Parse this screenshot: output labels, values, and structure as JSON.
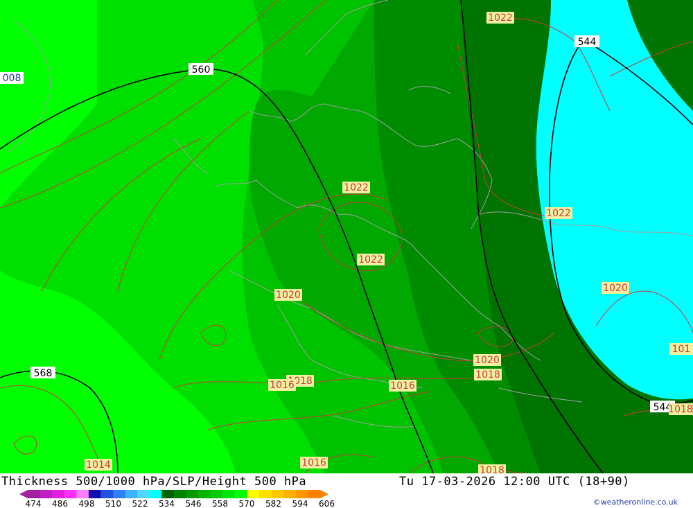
{
  "map": {
    "colors": {
      "outer": "#00ff00",
      "band1": "#00e000",
      "band2": "#00c300",
      "band3": "#00a800",
      "band4": "#008c00",
      "band5": "#007400",
      "cold": "#00ffff",
      "isobar": "#c83c3c",
      "height": "#000000",
      "border": "#a0a0a0"
    },
    "height_labels": [
      "560",
      "544",
      "568",
      "544"
    ],
    "pressure_labels": [
      "1022",
      "1022",
      "1022",
      "1022",
      "1020",
      "1020",
      "1020",
      "1018",
      "1018",
      "1016",
      "1016",
      "1014",
      "1016",
      "1018",
      "1018",
      "1018"
    ],
    "edge_labels": [
      "008",
      "101",
      "1018"
    ]
  },
  "footer": {
    "title": "Thickness 500/1000 hPa/SLP/Height 500 hPa",
    "valid": "Tu 17-03-2026 12:00 UTC (18+90)",
    "credit": "©weatheronline.co.uk"
  },
  "legend": {
    "ticks": [
      "474",
      "486",
      "498",
      "510",
      "522",
      "534",
      "546",
      "558",
      "570",
      "582",
      "594",
      "606"
    ],
    "colors": [
      "#a020a0",
      "#c020c0",
      "#e020e0",
      "#ff30ff",
      "#ff80ff",
      "#1010b0",
      "#2050e0",
      "#3080ff",
      "#40b0ff",
      "#50d8ff",
      "#00ffff",
      "#006400",
      "#008000",
      "#009a00",
      "#00b400",
      "#00cc00",
      "#00e600",
      "#00ff00",
      "#ffff00",
      "#ffe000",
      "#ffc800",
      "#ffb000",
      "#ff9800",
      "#ff8000"
    ]
  }
}
